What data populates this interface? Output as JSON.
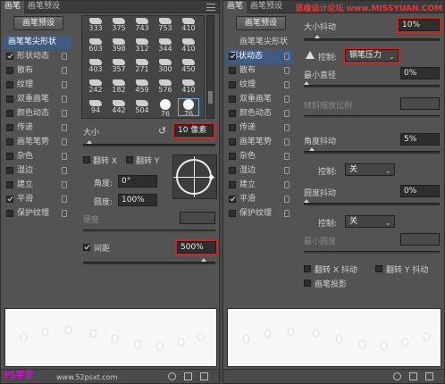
{
  "left": {
    "tabs": [
      "画笔",
      "画笔预设"
    ],
    "preset_button": "画笔预设",
    "side_items": [
      {
        "label": "画笔笔尖形状",
        "checked": null,
        "selected": true
      },
      {
        "label": "形状动态",
        "checked": true
      },
      {
        "label": "散布",
        "checked": false
      },
      {
        "label": "纹理",
        "checked": false
      },
      {
        "label": "双重画笔",
        "checked": false
      },
      {
        "label": "颜色动态",
        "checked": false
      },
      {
        "label": "传递",
        "checked": false
      },
      {
        "label": "画笔笔势",
        "checked": false
      },
      {
        "label": "杂色",
        "checked": false
      },
      {
        "label": "湿边",
        "checked": false
      },
      {
        "label": "建立",
        "checked": false
      },
      {
        "label": "平滑",
        "checked": true
      },
      {
        "label": "保护纹理",
        "checked": false
      }
    ],
    "brush_sizes": [
      "333",
      "375",
      "743",
      "753",
      "410",
      "603",
      "398",
      "312",
      "344",
      "410",
      "403",
      "357",
      "271",
      "300",
      "450",
      "242",
      "182",
      "459",
      "576",
      "410",
      "94",
      "442",
      "504",
      "76",
      "76"
    ],
    "size_label": "大小",
    "size_value": "10 像素",
    "flip_x": "翻转 X",
    "flip_y": "翻转 Y",
    "angle_label": "角度:",
    "angle_value": "0°",
    "roundness_label": "圆度:",
    "roundness_value": "100%",
    "hardness_label": "硬度",
    "spacing_label": "间距",
    "spacing_value": "500%"
  },
  "right": {
    "tabs": [
      "画笔",
      "画笔预设"
    ],
    "watermark": "思缘设计论坛 www.MISSYUAN.COM",
    "preset_button": "画笔预设",
    "side_items": [
      {
        "label": "画笔笔尖形状",
        "checked": null
      },
      {
        "label": "形状动态",
        "checked": true,
        "selected": true
      },
      {
        "label": "散布",
        "checked": false
      },
      {
        "label": "纹理",
        "checked": false
      },
      {
        "label": "双重画笔",
        "checked": false
      },
      {
        "label": "颜色动态",
        "checked": false
      },
      {
        "label": "传递",
        "checked": false
      },
      {
        "label": "画笔笔势",
        "checked": false
      },
      {
        "label": "杂色",
        "checked": false
      },
      {
        "label": "湿边",
        "checked": false
      },
      {
        "label": "建立",
        "checked": false
      },
      {
        "label": "平滑",
        "checked": true
      },
      {
        "label": "保护纹理",
        "checked": false
      }
    ],
    "size_jitter_label": "大小抖动",
    "size_jitter_value": "10%",
    "control_label": "控制:",
    "control_value": "钢笔压力",
    "min_diameter_label": "最小直径",
    "min_diameter_value": "0%",
    "tilt_scale_label": "倾斜缩放比例",
    "angle_jitter_label": "角度抖动",
    "angle_jitter_value": "5%",
    "control2_label": "控制:",
    "control2_value": "关",
    "roundness_jitter_label": "圆度抖动",
    "roundness_jitter_value": "0%",
    "control3_label": "控制:",
    "control3_value": "关",
    "min_roundness_label": "最小圆度",
    "flip_x_jitter": "翻转 X 抖动",
    "flip_y_jitter": "翻转 Y 抖动",
    "brush_projection": "画笔投影"
  },
  "footer": {
    "watermark": "PS学堂",
    "site": "www.52psxt.com"
  }
}
